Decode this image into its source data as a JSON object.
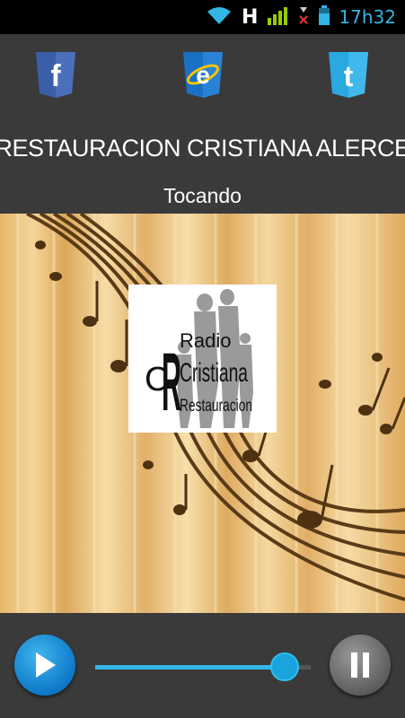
{
  "status_bar": {
    "network_label": "H",
    "time": "17h32",
    "accent_color": "#33b5e5"
  },
  "social": {
    "facebook_icon": "facebook-icon",
    "browser_icon": "internet-explorer-icon",
    "twitter_icon": "twitter-icon",
    "facebook_letter": "f",
    "browser_letter": "e",
    "twitter_letter": "t"
  },
  "station": {
    "title": "RESTAURACION CRISTIANA ALERCE",
    "now_playing": "Tocando"
  },
  "logo": {
    "line1": "Radio",
    "line2": "Cristiana",
    "line3": "Restauracion"
  },
  "player": {
    "volume_fraction": 0.88,
    "play_icon": "play-icon",
    "pause_icon": "pause-icon"
  }
}
